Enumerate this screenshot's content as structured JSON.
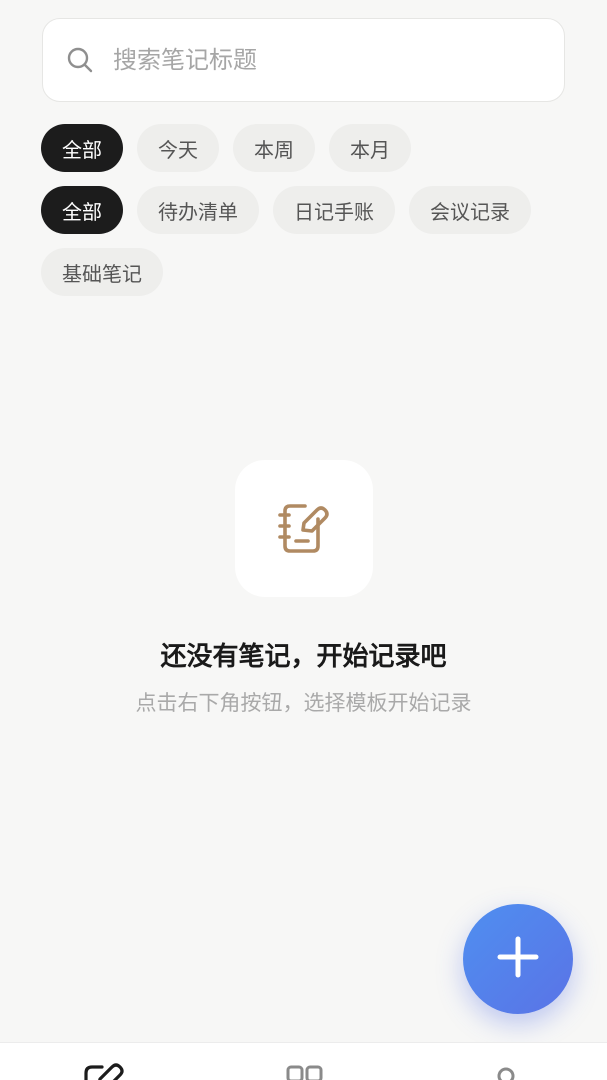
{
  "search": {
    "placeholder": "搜索笔记标题",
    "value": ""
  },
  "time_filters": [
    {
      "label": "全部",
      "active": true
    },
    {
      "label": "今天",
      "active": false
    },
    {
      "label": "本周",
      "active": false
    },
    {
      "label": "本月",
      "active": false
    }
  ],
  "type_filters": [
    {
      "label": "全部",
      "active": true
    },
    {
      "label": "待办清单",
      "active": false
    },
    {
      "label": "日记手账",
      "active": false
    },
    {
      "label": "会议记录",
      "active": false
    },
    {
      "label": "基础笔记",
      "active": false
    }
  ],
  "empty_state": {
    "title": "还没有笔记，开始记录吧",
    "subtitle": "点击右下角按钮，选择模板开始记录",
    "icon": "notebook-edit-icon"
  },
  "fab": {
    "icon": "plus-icon"
  },
  "tabbar": {
    "icons": [
      "notes-tab-icon",
      "templates-tab-icon",
      "profile-tab-icon"
    ]
  },
  "colors": {
    "background": "#f7f7f6",
    "chip_active": "#1c1c1c",
    "chip_inactive": "#eeeeec",
    "empty_icon": "#b08a62",
    "fab_gradient_start": "#4f8ff0",
    "fab_gradient_end": "#5a73e6"
  }
}
